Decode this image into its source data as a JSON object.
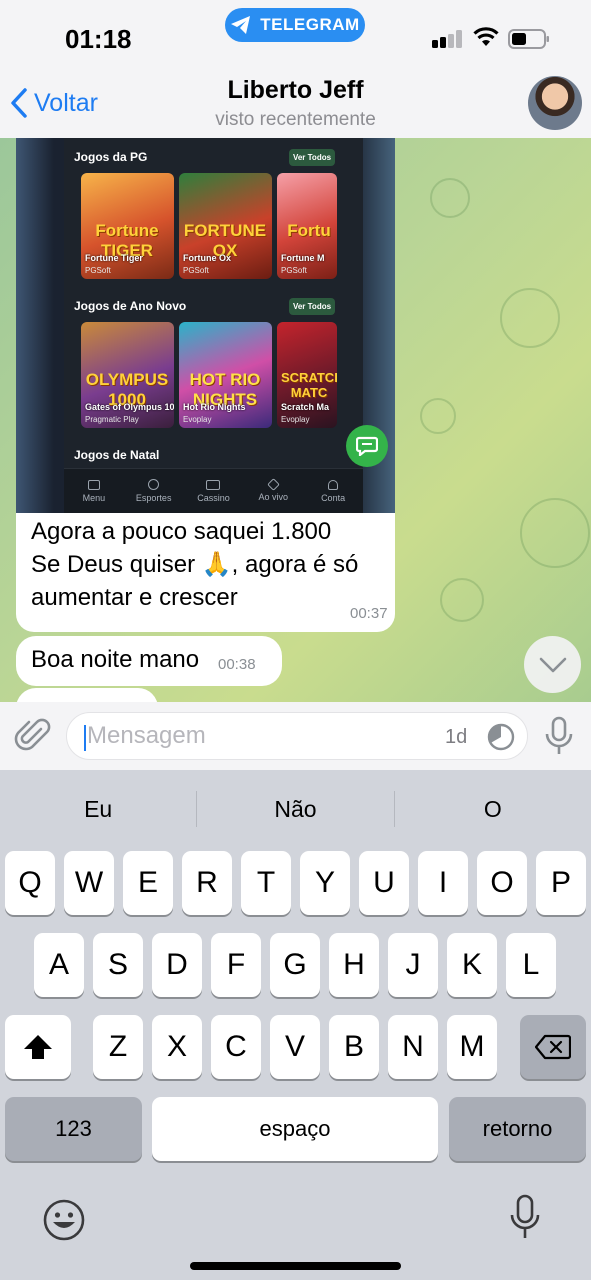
{
  "status": {
    "time": "01:18",
    "pill": "TELEGRAM"
  },
  "nav": {
    "back": "Voltar",
    "title": "Liberto Jeff",
    "subtitle": "visto recentemente"
  },
  "screenshot": {
    "section1": "Jogos da PG",
    "section2": "Jogos de Ano Novo",
    "section3": "Jogos de Natal",
    "see_all": "Ver Todos",
    "row1": [
      {
        "name": "Fortune Tiger",
        "provider": "PGSoft",
        "logo": "Fortune TIGER"
      },
      {
        "name": "Fortune Ox",
        "provider": "PGSoft",
        "logo": "FORTUNE OX"
      },
      {
        "name": "Fortune M",
        "provider": "PGSoft",
        "logo": "Fortu"
      }
    ],
    "row2": [
      {
        "name": "Gates of Olympus 1000",
        "provider": "Pragmatic Play",
        "logo": "OLYMPUS 1000"
      },
      {
        "name": "Hot Rio Nights",
        "provider": "Evoplay",
        "logo": "HOT RIO NIGHTS"
      },
      {
        "name": "Scratch Ma",
        "provider": "Evoplay",
        "logo": "SCRATCH MATC"
      }
    ],
    "tabs": [
      "Menu",
      "Esportes",
      "Cassino",
      "Ao vivo",
      "Conta"
    ]
  },
  "messages": [
    {
      "lines": [
        "Agora a pouco saquei 1.800",
        "Se Deus quiser 🙏, agora é só",
        "aumentar e crescer"
      ],
      "time": "00:37"
    },
    {
      "text": "Boa noite mano",
      "time": "00:38"
    }
  ],
  "input": {
    "placeholder": "Mensagem",
    "timer": "1d"
  },
  "keyboard": {
    "suggestions": [
      "Eu",
      "Não",
      "O"
    ],
    "row1": [
      "Q",
      "W",
      "E",
      "R",
      "T",
      "Y",
      "U",
      "I",
      "O",
      "P"
    ],
    "row2": [
      "A",
      "S",
      "D",
      "F",
      "G",
      "H",
      "J",
      "K",
      "L"
    ],
    "row3": [
      "Z",
      "X",
      "C",
      "V",
      "B",
      "N",
      "M"
    ],
    "numbers": "123",
    "space": "espaço",
    "return": "retorno"
  }
}
